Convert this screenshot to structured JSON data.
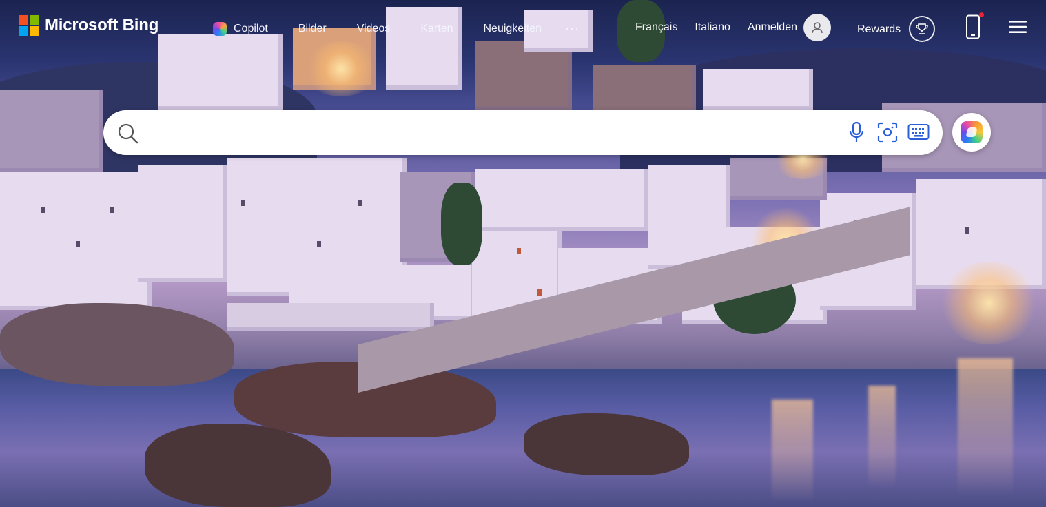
{
  "brand": {
    "name": "Microsoft Bing"
  },
  "nav": {
    "items": [
      {
        "label": "Copilot",
        "icon": "copilot-icon"
      },
      {
        "label": "Bilder"
      },
      {
        "label": "Videos"
      },
      {
        "label": "Karten"
      },
      {
        "label": "Neuigkeiten"
      }
    ],
    "more_label": "···"
  },
  "header_right": {
    "lang1": "Français",
    "lang2": "Italiano",
    "signin": "Anmelden",
    "rewards": "Rewards"
  },
  "search": {
    "value": "",
    "placeholder": "",
    "tools": [
      "microphone-icon",
      "visual-search-icon",
      "keyboard-icon"
    ]
  },
  "colors": {
    "accent": "#2b5fd9",
    "notification": "#e22233"
  }
}
